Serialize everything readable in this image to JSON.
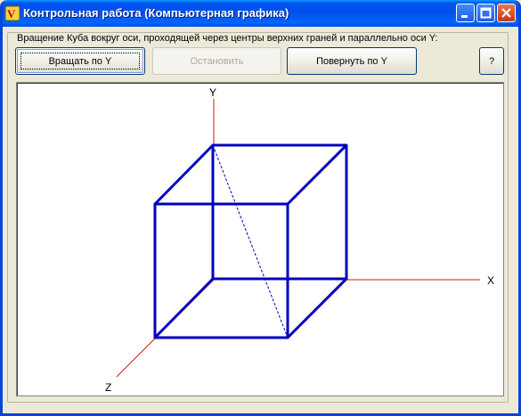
{
  "window": {
    "title": "Контрольная работа (Компьютерная графика)"
  },
  "group": {
    "label": "Вращение Куба вокруг оси, проходящей через центры верхних граней и параллельно оси Y:"
  },
  "buttons": {
    "rotate": "Вращать по Y",
    "stop": "Остановить",
    "turn": "Повернуть по Y",
    "help": "?"
  },
  "axes": {
    "x": "X",
    "y": "Y",
    "z": "Z"
  },
  "colors": {
    "axis": "#e01010",
    "cube": "#0000c0"
  }
}
